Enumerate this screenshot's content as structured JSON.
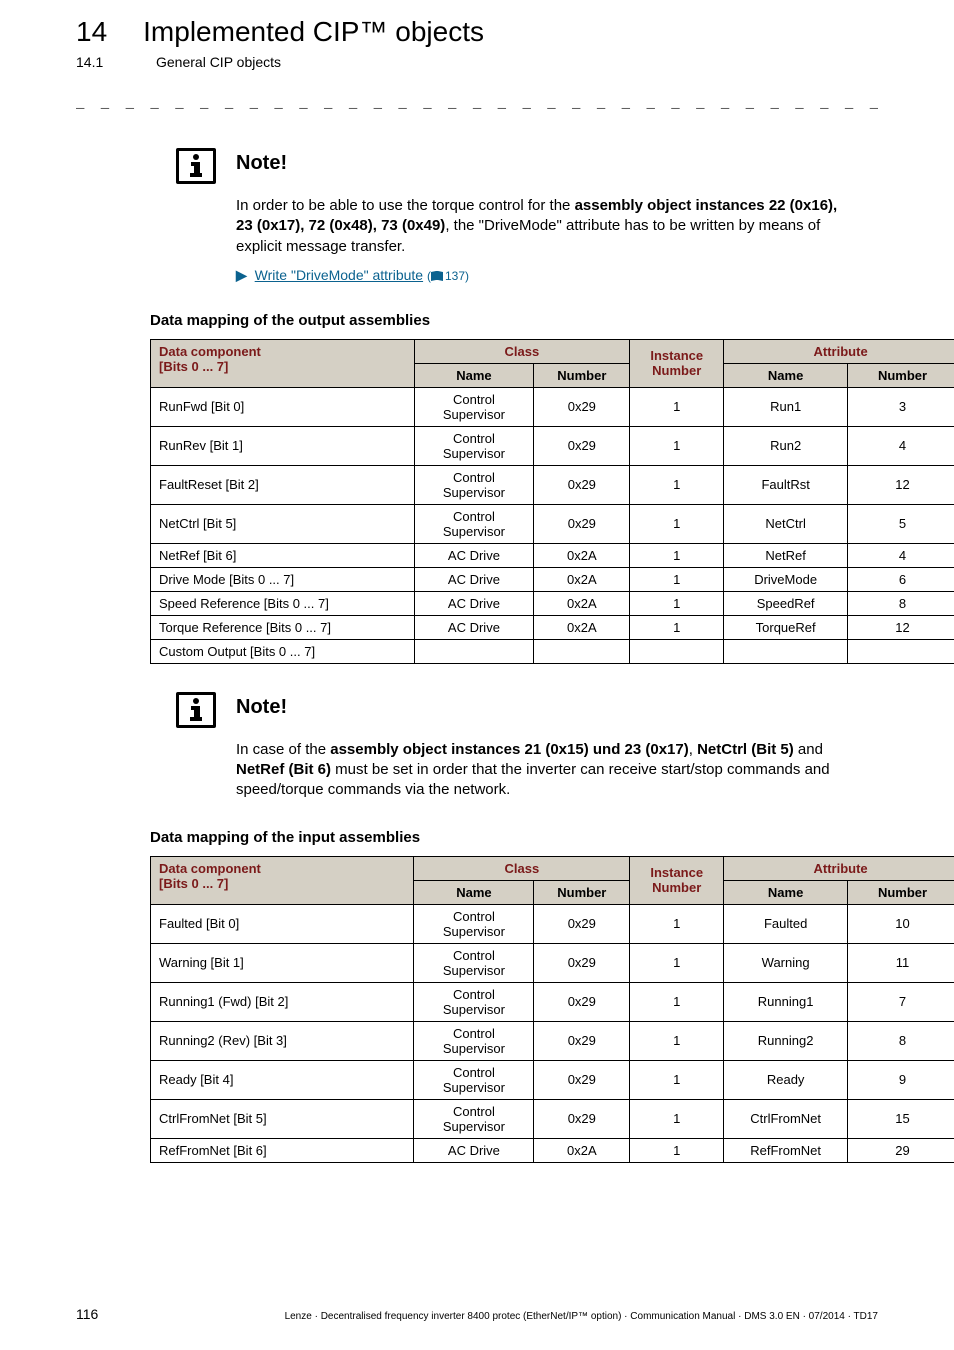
{
  "header": {
    "chapter_number": "14",
    "chapter_title": "Implemented CIP™ objects",
    "section_number": "14.1",
    "section_title": "General CIP objects"
  },
  "note1": {
    "heading": "Note!",
    "text_pre": "In order to be able to use the torque control for the ",
    "text_bold": "assembly object instances 22 (0x16), 23 (0x17), 72 (0x48), 73 (0x49)",
    "text_post": ", the \"DriveMode\" attribute has to be written by means of explicit message transfer.",
    "link_text": "Write \"DriveMode\" attribute",
    "link_ref": "137"
  },
  "table1": {
    "heading": "Data mapping of the output assemblies",
    "headers": {
      "comp": "Data component",
      "bits": "[Bits 0 ... 7]",
      "class": "Class",
      "class_name": "Name",
      "class_number": "Number",
      "instance": "Instance Number",
      "attribute": "Attribute",
      "attr_name": "Name",
      "attr_number": "Number"
    },
    "rows": [
      {
        "comp": "RunFwd [Bit 0]",
        "cname": "Control Supervisor",
        "cnum": "0x29",
        "inst": "1",
        "aname": "Run1",
        "anum": "3"
      },
      {
        "comp": "RunRev [Bit 1]",
        "cname": "Control Supervisor",
        "cnum": "0x29",
        "inst": "1",
        "aname": "Run2",
        "anum": "4"
      },
      {
        "comp": "FaultReset [Bit 2]",
        "cname": "Control Supervisor",
        "cnum": "0x29",
        "inst": "1",
        "aname": "FaultRst",
        "anum": "12"
      },
      {
        "comp": "NetCtrl [Bit 5]",
        "cname": "Control Supervisor",
        "cnum": "0x29",
        "inst": "1",
        "aname": "NetCtrl",
        "anum": "5"
      },
      {
        "comp": "NetRef [Bit 6]",
        "cname": "AC Drive",
        "cnum": "0x2A",
        "inst": "1",
        "aname": "NetRef",
        "anum": "4"
      },
      {
        "comp": "Drive Mode [Bits 0 ... 7]",
        "cname": "AC Drive",
        "cnum": "0x2A",
        "inst": "1",
        "aname": "DriveMode",
        "anum": "6"
      },
      {
        "comp": "Speed Reference [Bits 0 ... 7]",
        "cname": "AC Drive",
        "cnum": "0x2A",
        "inst": "1",
        "aname": "SpeedRef",
        "anum": "8"
      },
      {
        "comp": "Torque Reference [Bits 0 ... 7]",
        "cname": "AC Drive",
        "cnum": "0x2A",
        "inst": "1",
        "aname": "TorqueRef",
        "anum": "12"
      },
      {
        "comp": "Custom Output [Bits 0 ... 7]",
        "cname": "",
        "cnum": "",
        "inst": "",
        "aname": "",
        "anum": ""
      }
    ]
  },
  "note2": {
    "heading": "Note!",
    "t1": "In case of the ",
    "b1": "assembly object instances 21 (0x15) und 23 (0x17)",
    "t2": ", ",
    "b2": "NetCtrl (Bit 5)",
    "t3": " and ",
    "b3": "NetRef (Bit 6)",
    "t4": " must be set in order that the inverter can receive start/stop commands and speed/torque commands via the network."
  },
  "table2": {
    "heading": "Data mapping of the input assemblies",
    "rows": [
      {
        "comp": "Faulted [Bit 0]",
        "cname": "Control Supervisor",
        "cnum": "0x29",
        "inst": "1",
        "aname": "Faulted",
        "anum": "10"
      },
      {
        "comp": "Warning [Bit 1]",
        "cname": "Control Supervisor",
        "cnum": "0x29",
        "inst": "1",
        "aname": "Warning",
        "anum": "11"
      },
      {
        "comp": "Running1 (Fwd) [Bit 2]",
        "cname": "Control Supervisor",
        "cnum": "0x29",
        "inst": "1",
        "aname": "Running1",
        "anum": "7"
      },
      {
        "comp": "Running2 (Rev) [Bit 3]",
        "cname": "Control Supervisor",
        "cnum": "0x29",
        "inst": "1",
        "aname": "Running2",
        "anum": "8"
      },
      {
        "comp": "Ready [Bit 4]",
        "cname": "Control Supervisor",
        "cnum": "0x29",
        "inst": "1",
        "aname": "Ready",
        "anum": "9"
      },
      {
        "comp": "CtrlFromNet [Bit 5]",
        "cname": "Control Supervisor",
        "cnum": "0x29",
        "inst": "1",
        "aname": "CtrlFromNet",
        "anum": "15"
      },
      {
        "comp": "RefFromNet [Bit 6]",
        "cname": "AC Drive",
        "cnum": "0x2A",
        "inst": "1",
        "aname": "RefFromNet",
        "anum": "29"
      }
    ]
  },
  "footer": {
    "page": "116",
    "text": "Lenze · Decentralised frequency inverter 8400 protec (EtherNet/IP™ option) · Communication Manual · DMS 3.0 EN · 07/2014 · TD17"
  }
}
